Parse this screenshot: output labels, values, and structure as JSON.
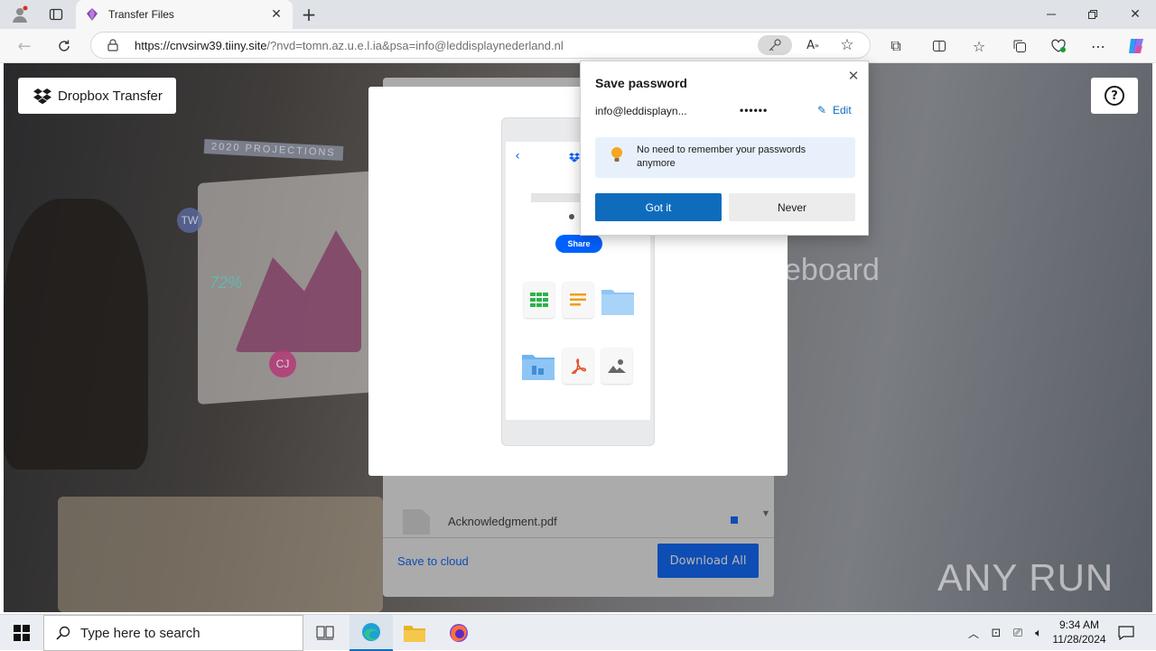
{
  "browser": {
    "tab_title": "Transfer Files",
    "url_host": "https://cnvsirw39.tiiny.site",
    "url_rest": "/?nvd=tomn.az.u.e.l.ia&psa=info@leddisplaynederland.nl"
  },
  "page": {
    "brand_label": "Dropbox Transfer",
    "bg_text_projections": "2020 PROJECTIONS",
    "bg_text_board": "eboard",
    "avatar_tw": "TW",
    "avatar_cj": "CJ",
    "chart_label": "72%",
    "share_label": "Share",
    "file_name": "Acknowledgment.pdf",
    "save_to_cloud": "Save to cloud",
    "download_all": "Download All",
    "watermark": "ANY RUN"
  },
  "password_popup": {
    "title": "Save password",
    "username": "info@leddisplayn...",
    "password_mask": "••••••",
    "edit_label": "Edit",
    "tip_line1": "No need to remember your passwords",
    "tip_line2": "anymore",
    "gotit_label": "Got it",
    "never_label": "Never"
  },
  "taskbar": {
    "search_placeholder": "Type here to search",
    "time": "9:34 AM",
    "date": "11/28/2024"
  },
  "colors": {
    "accent_blue": "#0f6cbd",
    "dropbox_blue": "#0061fe",
    "tip_bg": "#e8f1fb"
  }
}
